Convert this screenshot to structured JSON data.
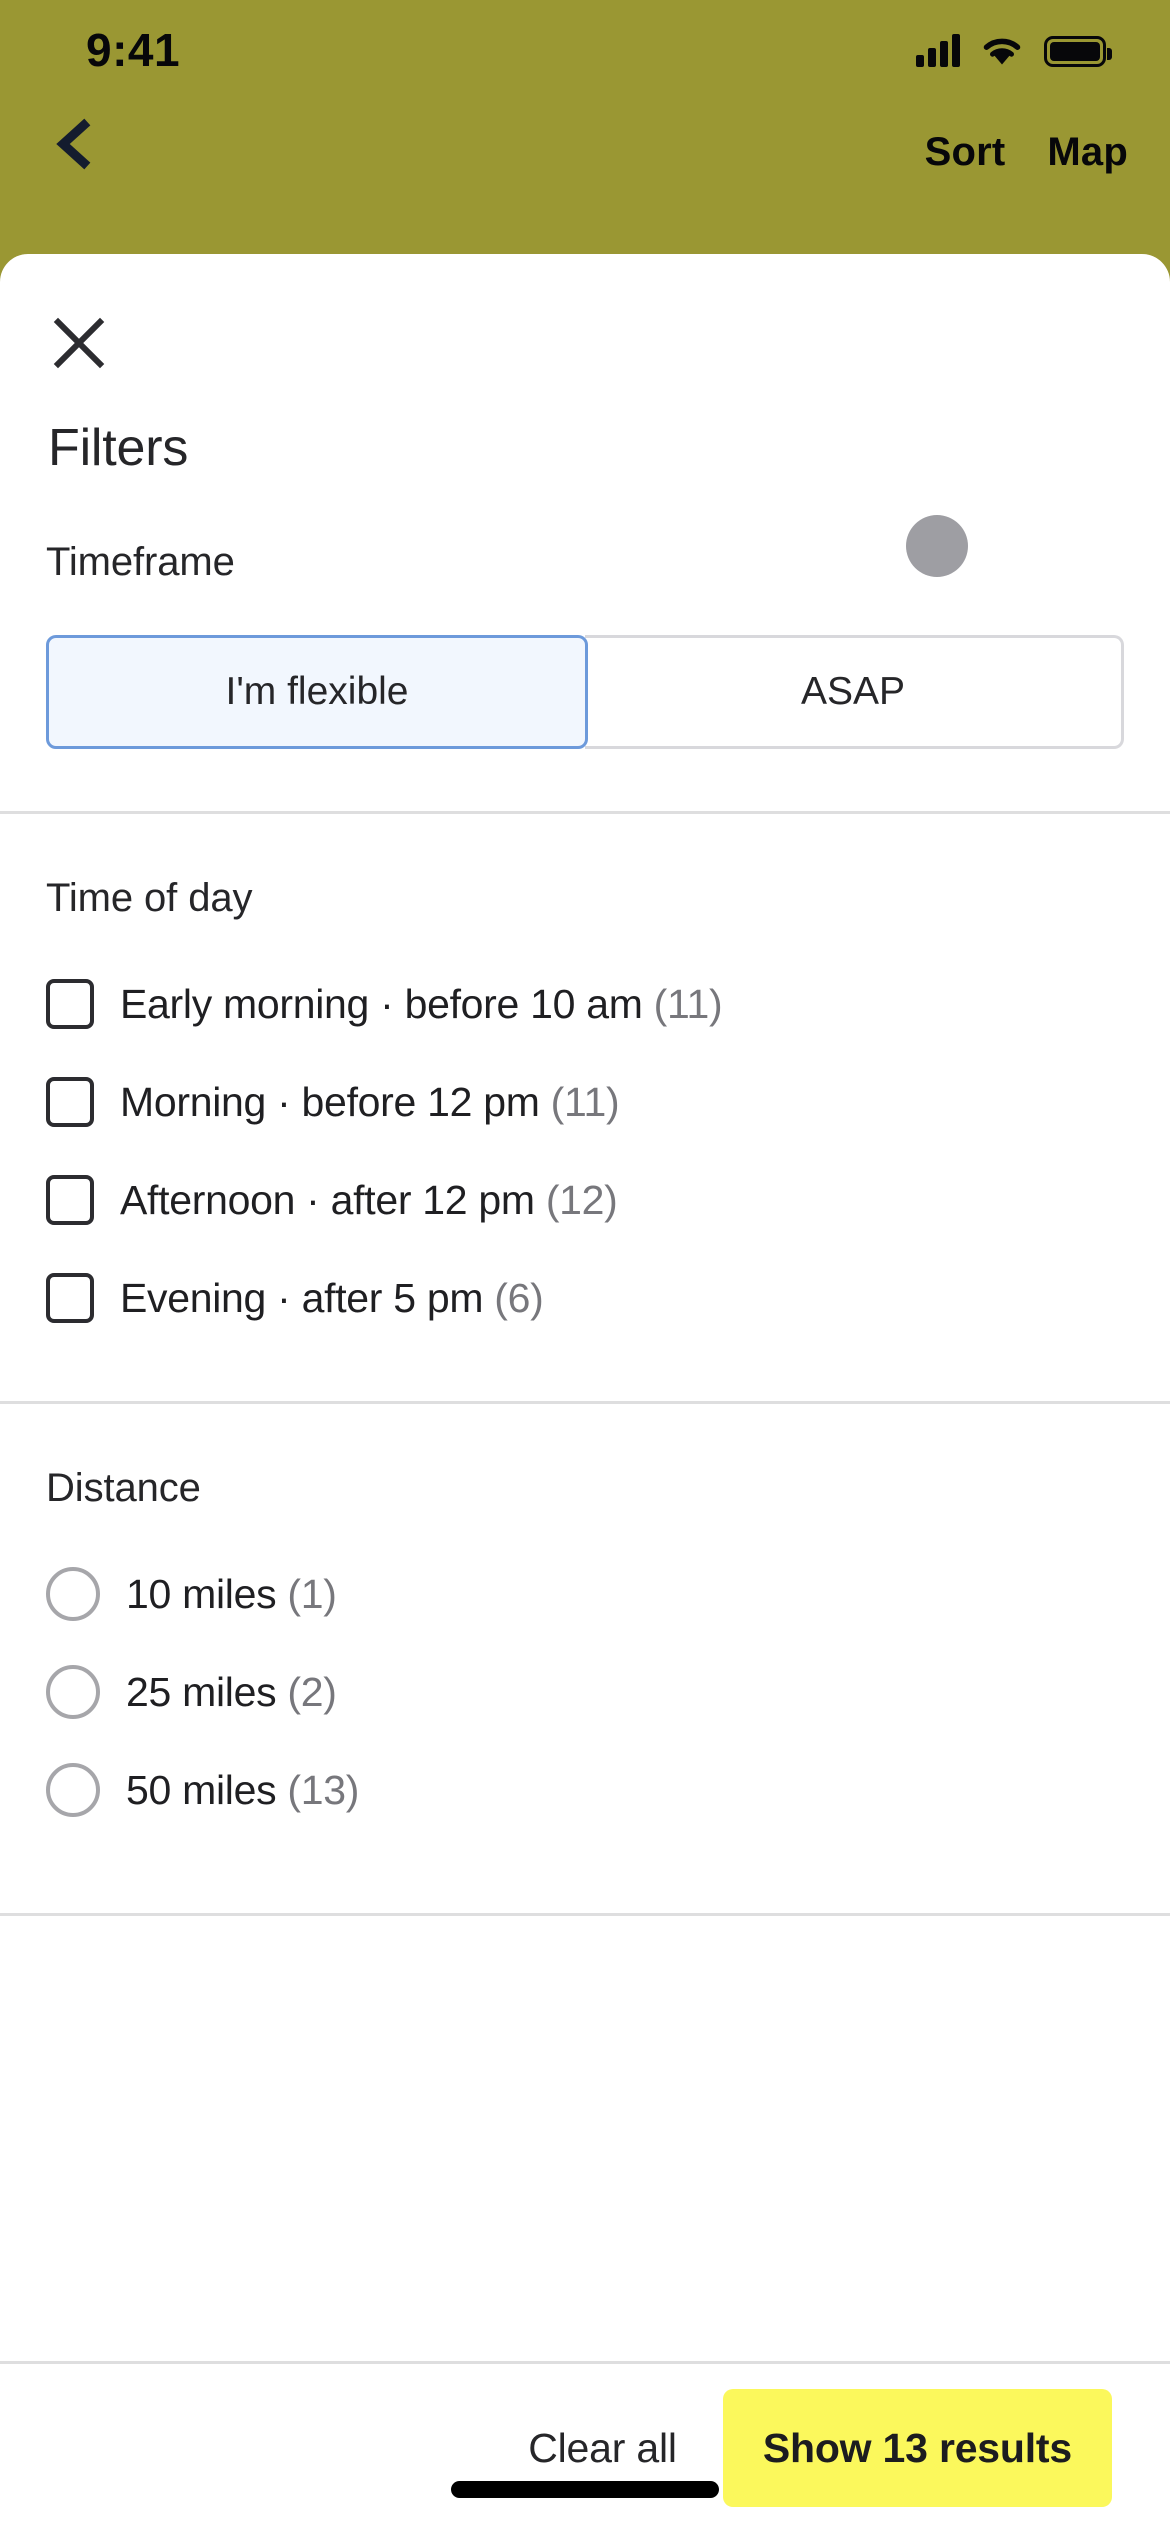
{
  "status_bar": {
    "time": "9:41",
    "icons": [
      "cellular-signal-icon",
      "wifi-icon",
      "battery-icon"
    ]
  },
  "nav_bar": {
    "back_icon": "chevron-left-icon",
    "actions": [
      {
        "label": "Sort",
        "name": "sort-button"
      },
      {
        "label": "Map",
        "name": "map-button"
      }
    ]
  },
  "sheet": {
    "close_icon": "close-icon",
    "title": "Filters",
    "timeframe": {
      "label": "Timeframe",
      "options": [
        {
          "label": "I'm flexible",
          "selected": true
        },
        {
          "label": "ASAP",
          "selected": false
        }
      ]
    },
    "time_of_day": {
      "label": "Time of day",
      "options": [
        {
          "label": "Early morning · before 10 am",
          "count": "(11)",
          "checked": false
        },
        {
          "label": "Morning · before 12 pm",
          "count": "(11)",
          "checked": false
        },
        {
          "label": "Afternoon · after 12 pm",
          "count": "(12)",
          "checked": false
        },
        {
          "label": "Evening · after 5 pm",
          "count": "(6)",
          "checked": false
        }
      ]
    },
    "distance": {
      "label": "Distance",
      "options": [
        {
          "label": "10 miles",
          "count": "(1)",
          "selected": false
        },
        {
          "label": "25 miles",
          "count": "(2)",
          "selected": false
        },
        {
          "label": "50 miles",
          "count": "(13)",
          "selected": false
        }
      ]
    },
    "footer": {
      "clear_label": "Clear all",
      "submit_label": "Show 13 results"
    }
  },
  "colors": {
    "background": "#9A9733",
    "accent_selected_border": "#6D9ADB",
    "accent_selected_fill": "#F2F7FE",
    "submit_button": "#FBF85C",
    "divider": "#DEDEDF",
    "text_primary": "#262629",
    "text_muted": "#77777C",
    "touch_dot": "#9E9EA3"
  }
}
